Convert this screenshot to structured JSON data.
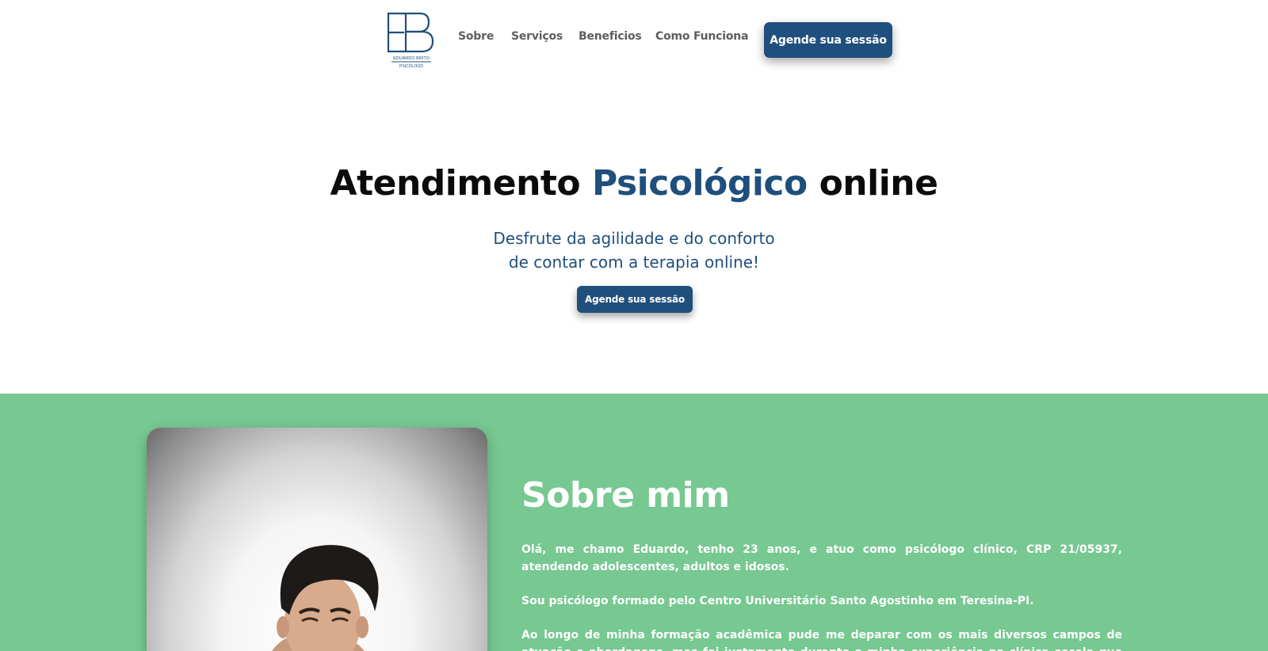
{
  "header": {
    "logo": {
      "monogram": "EB",
      "name": "EDUARDO BRITO",
      "subtitle": "PSICÓLOGO",
      "color": "#1f4f7c"
    },
    "nav": [
      "Sobre",
      "Serviços",
      "Beneficios",
      "Como Funciona"
    ],
    "cta_label": "Agende sua sessão"
  },
  "hero": {
    "title_part1": "Atendimento ",
    "title_accent": "Psicológico",
    "title_part2": " online",
    "subtitle_line1": "Desfrute da agilidade e do conforto",
    "subtitle_line2": "de contar com a terapia online!",
    "cta_label": "Agende sua sessão"
  },
  "about": {
    "background_color": "#77c891",
    "title": "Sobre mim",
    "paragraph1": "Olá, me chamo Eduardo, tenho 23 anos, e atuo como psicólogo clínico, CRP 21/05937, atendendo adolescentes, adultos e idosos.",
    "paragraph2": "Sou psicólogo formado pelo Centro Universitário Santo Agostinho em Teresina-PI.",
    "paragraph3": "Ao longo de minha formação acadêmica pude me deparar com os mais diversos campos de atuação e abordagens, mas foi justamente durante a minha experiência na clínica escola que pude perceber a minha"
  },
  "colors": {
    "brand": "#1f4f7c",
    "about_bg": "#77c891"
  }
}
